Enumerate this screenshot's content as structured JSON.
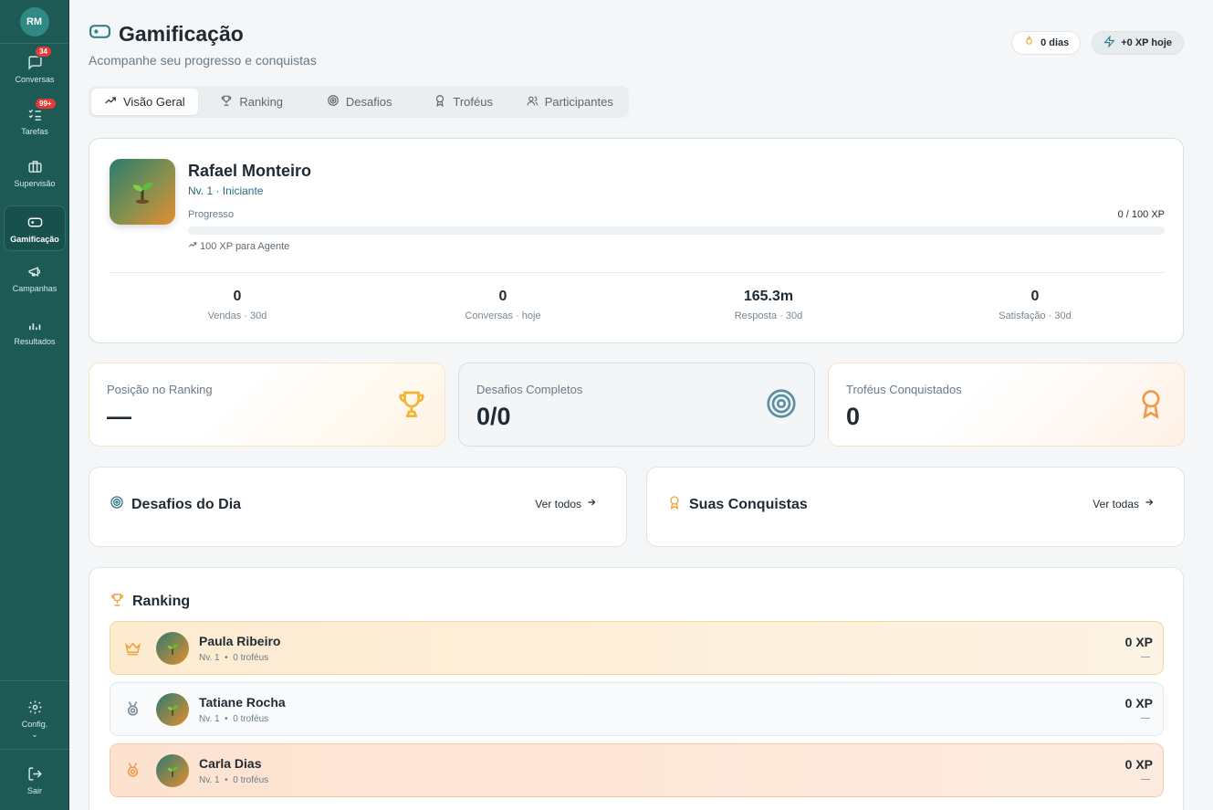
{
  "sidebar": {
    "avatar": "RM",
    "items": [
      {
        "label": "Conversas",
        "icon": "chat-icon",
        "badge": "34"
      },
      {
        "label": "Tarefas",
        "icon": "tasks-icon",
        "badge": "99+"
      },
      {
        "label": "Supervisão",
        "icon": "briefcase-icon",
        "badge": ""
      },
      {
        "label": "Gamificação",
        "icon": "gamepad-icon",
        "badge": "",
        "active": true
      },
      {
        "label": "Campanhas",
        "icon": "megaphone-icon",
        "badge": ""
      },
      {
        "label": "Resultados",
        "icon": "bar-chart-icon",
        "badge": ""
      }
    ],
    "config": "Config.",
    "logout": "Sair"
  },
  "header": {
    "title": "Gamificação",
    "subtitle": "Acompanhe seu progresso e conquistas",
    "streak": "0 dias",
    "xp_today": "+0 XP hoje"
  },
  "tabs": [
    "Visão Geral",
    "Ranking",
    "Desafios",
    "Troféus",
    "Participantes"
  ],
  "profile": {
    "name": "Rafael Monteiro",
    "level": "Nv. 1 · Iniciante",
    "progress_label": "Progresso",
    "progress_value": "0 / 100 XP",
    "progress_fraction": 0,
    "next_note": "100 XP para Agente",
    "stats": [
      {
        "value": "0",
        "label": "Vendas · 30d"
      },
      {
        "value": "0",
        "label": "Conversas · hoje"
      },
      {
        "value": "165.3m",
        "label": "Resposta · 30d"
      },
      {
        "value": "0",
        "label": "Satisfação · 30d"
      }
    ]
  },
  "kpis": [
    {
      "label": "Posição no Ranking",
      "value": "—",
      "icon": "trophy-icon"
    },
    {
      "label": "Desafios Completos",
      "value": "0/0",
      "icon": "target-icon"
    },
    {
      "label": "Troféus Conquistados",
      "value": "0",
      "icon": "award-icon"
    }
  ],
  "daily": {
    "title": "Desafios do Dia",
    "link": "Ver todos"
  },
  "achievements": {
    "title": "Suas Conquistas",
    "link": "Ver todas"
  },
  "ranking": {
    "title": "Ranking",
    "rows": [
      {
        "name": "Paula Ribeiro",
        "level": "Nv. 1",
        "trophies": "0 troféus",
        "xp": "0 XP",
        "dash": "—"
      },
      {
        "name": "Tatiane Rocha",
        "level": "Nv. 1",
        "trophies": "0 troféus",
        "xp": "0 XP",
        "dash": "—"
      },
      {
        "name": "Carla Dias",
        "level": "Nv. 1",
        "trophies": "0 troféus",
        "xp": "0 XP",
        "dash": "—"
      }
    ]
  },
  "colors": {
    "sidebar": "#1d5a56",
    "accent": "#2b8a80",
    "gold": "#f5b335",
    "bronze": "#ee9b4c"
  }
}
